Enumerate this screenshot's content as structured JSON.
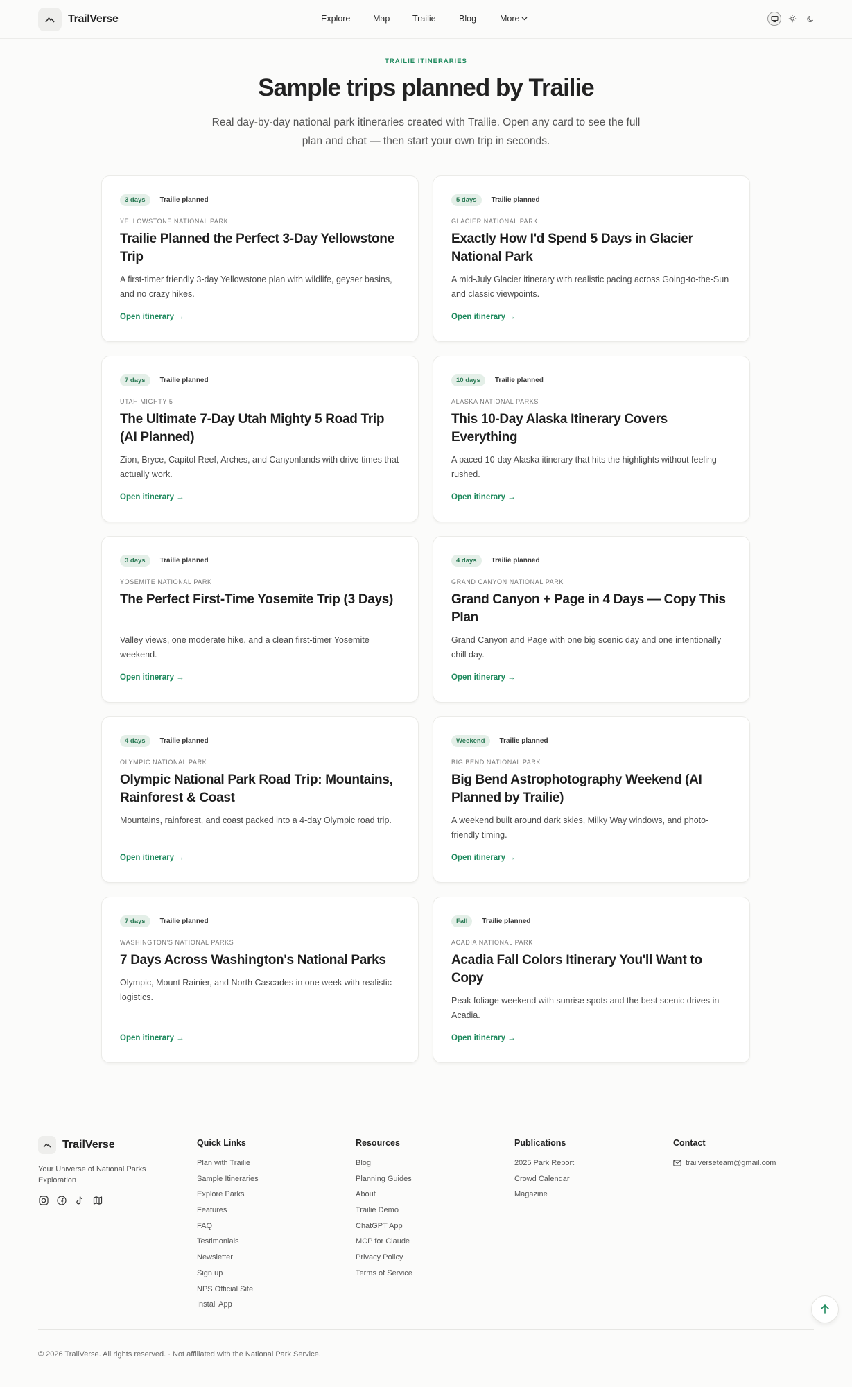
{
  "header": {
    "brand": "TrailVerse",
    "nav": [
      "Explore",
      "Map",
      "Trailie",
      "Blog",
      "More"
    ]
  },
  "hero": {
    "eyebrow": "TRAILIE ITINERARIES",
    "title": "Sample trips planned by Trailie",
    "subtitle": "Real day-by-day national park itineraries created with Trailie. Open any card to see the full plan and chat — then start your own trip in seconds."
  },
  "cards": [
    {
      "days": "3 days",
      "tag": "Trailie planned",
      "park": "YELLOWSTONE NATIONAL PARK",
      "title": "Trailie Planned the Perfect 3-Day Yellowstone Trip",
      "desc": "A first-timer friendly 3-day Yellowstone plan with wildlife, geyser basins, and no crazy hikes.",
      "link": "Open itinerary →"
    },
    {
      "days": "5 days",
      "tag": "Trailie planned",
      "park": "GLACIER NATIONAL PARK",
      "title": "Exactly How I'd Spend 5 Days in Glacier National Park",
      "desc": "A mid-July Glacier itinerary with realistic pacing across Going-to-the-Sun and classic viewpoints.",
      "link": "Open itinerary →"
    },
    {
      "days": "7 days",
      "tag": "Trailie planned",
      "park": "UTAH MIGHTY 5",
      "title": "The Ultimate 7-Day Utah Mighty 5 Road Trip (AI Planned)",
      "desc": "Zion, Bryce, Capitol Reef, Arches, and Canyonlands with drive times that actually work.",
      "link": "Open itinerary →"
    },
    {
      "days": "10 days",
      "tag": "Trailie planned",
      "park": "ALASKA NATIONAL PARKS",
      "title": "This 10-Day Alaska Itinerary Covers Everything",
      "desc": "A paced 10-day Alaska itinerary that hits the highlights without feeling rushed.",
      "link": "Open itinerary →"
    },
    {
      "days": "3 days",
      "tag": "Trailie planned",
      "park": "YOSEMITE NATIONAL PARK",
      "title": "The Perfect First-Time Yosemite Trip (3 Days)",
      "desc": "Valley views, one moderate hike, and a clean first-timer Yosemite weekend.",
      "link": "Open itinerary →"
    },
    {
      "days": "4 days",
      "tag": "Trailie planned",
      "park": "GRAND CANYON NATIONAL PARK",
      "title": "Grand Canyon + Page in 4 Days — Copy This Plan",
      "desc": "Grand Canyon and Page with one big scenic day and one intentionally chill day.",
      "link": "Open itinerary →"
    },
    {
      "days": "4 days",
      "tag": "Trailie planned",
      "park": "OLYMPIC NATIONAL PARK",
      "title": "Olympic National Park Road Trip: Mountains, Rainforest & Coast",
      "desc": "Mountains, rainforest, and coast packed into a 4-day Olympic road trip.",
      "link": "Open itinerary →"
    },
    {
      "days": "Weekend",
      "tag": "Trailie planned",
      "park": "BIG BEND NATIONAL PARK",
      "title": "Big Bend Astrophotography Weekend (AI Planned by Trailie)",
      "desc": "A weekend built around dark skies, Milky Way windows, and photo-friendly timing.",
      "link": "Open itinerary →"
    },
    {
      "days": "7 days",
      "tag": "Trailie planned",
      "park": "WASHINGTON'S NATIONAL PARKS",
      "title": "7 Days Across Washington's National Parks",
      "desc": "Olympic, Mount Rainier, and North Cascades in one week with realistic logistics.",
      "link": "Open itinerary →"
    },
    {
      "days": "Fall",
      "tag": "Trailie planned",
      "park": "ACADIA NATIONAL PARK",
      "title": "Acadia Fall Colors Itinerary You'll Want to Copy",
      "desc": "Peak foliage weekend with sunrise spots and the best scenic drives in Acadia.",
      "link": "Open itinerary →"
    }
  ],
  "footer": {
    "brand": "TrailVerse",
    "tagline": "Your Universe of National Parks Exploration",
    "quick_links": {
      "title": "Quick Links",
      "items": [
        "Plan with Trailie",
        "Sample Itineraries",
        "Explore Parks",
        "Features",
        "FAQ",
        "Testimonials",
        "Newsletter",
        "Sign up",
        "NPS Official Site",
        "Install App"
      ]
    },
    "resources": {
      "title": "Resources",
      "items": [
        "Blog",
        "Planning Guides",
        "About",
        "Trailie Demo",
        "ChatGPT App",
        "MCP for Claude",
        "Privacy Policy",
        "Terms of Service"
      ]
    },
    "publications": {
      "title": "Publications",
      "items": [
        "2025 Park Report",
        "Crowd Calendar",
        "Magazine"
      ]
    },
    "contact": {
      "title": "Contact",
      "email": "trailverseteam@gmail.com"
    },
    "copyright": "© 2026 TrailVerse. All rights reserved. · Not affiliated with the National Park Service."
  },
  "colors": {
    "accent": "#1f8a5e",
    "pill_bg": "#e4efe8",
    "page_bg": "#fbfbfa"
  },
  "icons": {
    "logo": "mountain-icon",
    "social": [
      "instagram-icon",
      "facebook-icon",
      "tiktok-icon",
      "map-icon"
    ],
    "theme": [
      "monitor-icon",
      "sun-icon",
      "moon-icon"
    ]
  }
}
